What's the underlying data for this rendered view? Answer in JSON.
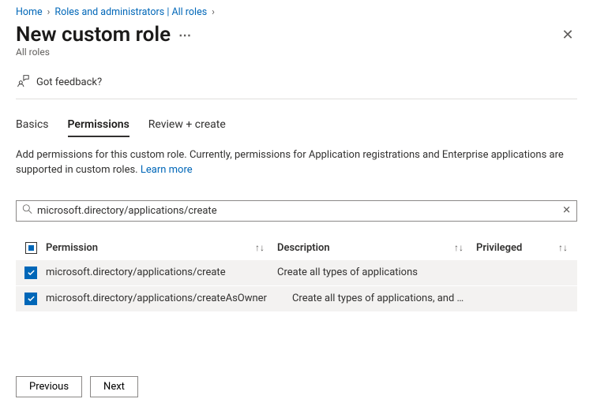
{
  "breadcrumb": {
    "home": "Home",
    "roles": "Roles and administrators | All roles"
  },
  "title": "New custom role",
  "subtitle": "All roles",
  "feedback": "Got feedback?",
  "tabs": {
    "basics": "Basics",
    "permissions": "Permissions",
    "review": "Review + create"
  },
  "description": "Add permissions for this custom role. Currently, permissions for Application registrations and Enterprise applications are supported in custom roles.",
  "learn_more": "Learn more",
  "search": {
    "value": "microsoft.directory/applications/create"
  },
  "table": {
    "headers": {
      "permission": "Permission",
      "description": "Description",
      "privileged": "Privileged"
    },
    "rows": [
      {
        "permission": "microsoft.directory/applications/create",
        "description": "Create all types of applications"
      },
      {
        "permission": "microsoft.directory/applications/createAsOwner",
        "description": "Create all types of applications, and …"
      }
    ]
  },
  "buttons": {
    "previous": "Previous",
    "next": "Next"
  }
}
